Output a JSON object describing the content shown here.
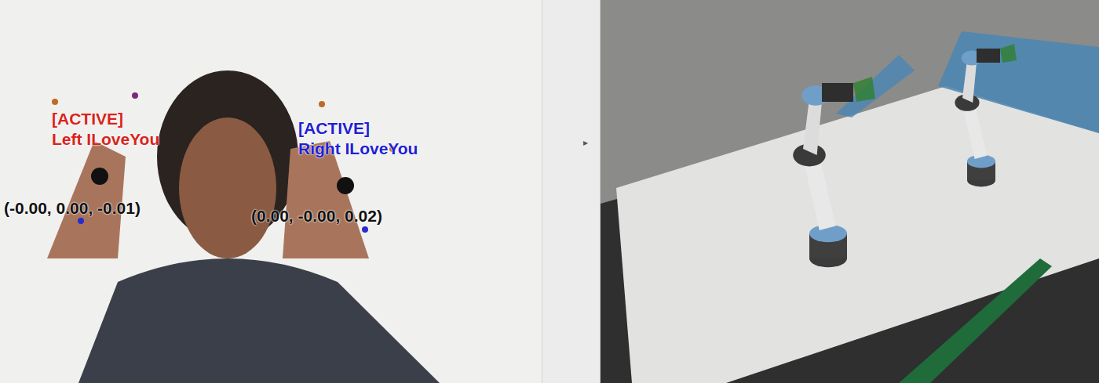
{
  "video": {
    "hands": [
      {
        "status": "[ACTIVE]",
        "label": "Left ILoveYou",
        "coords": "(-0.00, 0.00, -0.01)",
        "color": "#d9231b"
      },
      {
        "status": "[ACTIVE]",
        "label": "Right ILoveYou",
        "coords": "(0.00, -0.00, 0.02)",
        "color": "#1f1fd6"
      }
    ]
  },
  "splitter": {
    "handle": "▸"
  }
}
